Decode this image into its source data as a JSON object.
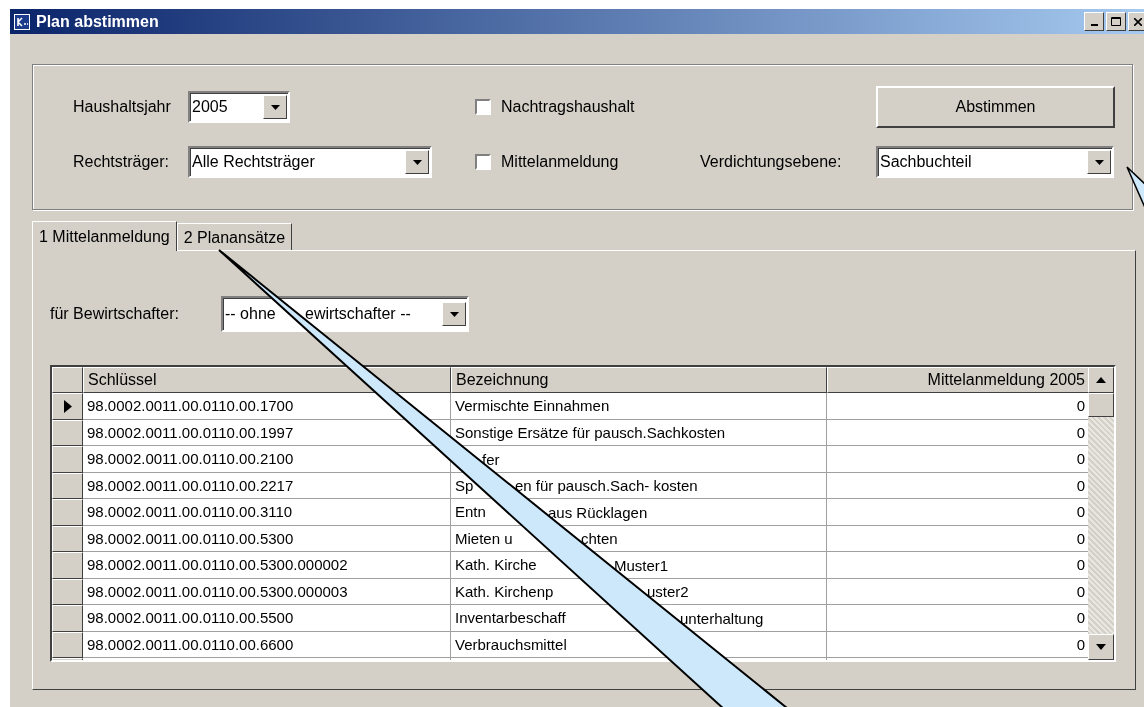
{
  "window": {
    "title": "Plan abstimmen"
  },
  "settings": {
    "haushaltsjahr": {
      "label": "Haushaltsjahr",
      "value": "2005"
    },
    "rechtstraeger": {
      "label": "Rechtsträger:",
      "value": "Alle Rechtsträger"
    },
    "checkboxes": [
      {
        "label": "Nachtragshaushalt",
        "checked": false
      },
      {
        "label": "Mittelanmeldung",
        "checked": false
      }
    ],
    "abstimmen_button": {
      "label": "Abstimmen"
    },
    "verdichtungsebene": {
      "label": "Verdichtungsebene:",
      "value": "Sachbuchteil"
    }
  },
  "tabs": [
    {
      "label": "1 Mittelanmeldung",
      "selected": true
    },
    {
      "label": "2 Planansätze",
      "selected": false
    }
  ],
  "bewirtschafter": {
    "label": "für Bewirtschafter:",
    "value": {
      "start": "-- ohne",
      "end": "ewirtschafter --"
    }
  },
  "table": {
    "columns": [
      "Schlüssel",
      "Bezeichnung",
      "Mittelanmeldung 2005"
    ],
    "rows": [
      {
        "key": "98.0002.0011.00.0110.00.1700",
        "description": {
          "start": "Vermischte Einnahmen"
        },
        "amount": "0",
        "selected": true
      },
      {
        "key": "98.0002.0011.00.0110.00.1997",
        "description": {
          "start": "Sonstige Ersätze für pausch.Sachkosten"
        },
        "amount": "0",
        "selected": false
      },
      {
        "key": "98.0002.0011.00.0110.00.2100",
        "description": {
          "end": "fer"
        },
        "amount": "0",
        "selected": false
      },
      {
        "key": "98.0002.0011.00.0110.00.2217",
        "description": {
          "start": "Sp",
          "end": "en für pausch.Sach- kosten"
        },
        "amount": "0",
        "selected": false
      },
      {
        "key": "98.0002.0011.00.0110.00.3110",
        "description": {
          "start": "Entn",
          "end": "aus Rücklagen"
        },
        "amount": "0",
        "selected": false
      },
      {
        "key": "98.0002.0011.00.0110.00.5300",
        "description": {
          "start": "Mieten u",
          "end": "chten"
        },
        "amount": "0",
        "selected": false
      },
      {
        "key": "98.0002.0011.00.0110.00.5300.000002",
        "description": {
          "start": "Kath. Kirche",
          "end": "Muster1"
        },
        "amount": "0",
        "selected": false
      },
      {
        "key": "98.0002.0011.00.0110.00.5300.000003",
        "description": {
          "start": "Kath. Kirchenp",
          "end": "uster2"
        },
        "amount": "0",
        "selected": false
      },
      {
        "key": "98.0002.0011.00.0110.00.5500",
        "description": {
          "start": "Inventarbeschaff",
          "end": "unterhaltung"
        },
        "amount": "0",
        "selected": false
      },
      {
        "key": "98.0002.0011.00.0110.00.6600",
        "description": {
          "start": "Verbrauchsmittel"
        },
        "amount": "0",
        "selected": false
      }
    ]
  }
}
